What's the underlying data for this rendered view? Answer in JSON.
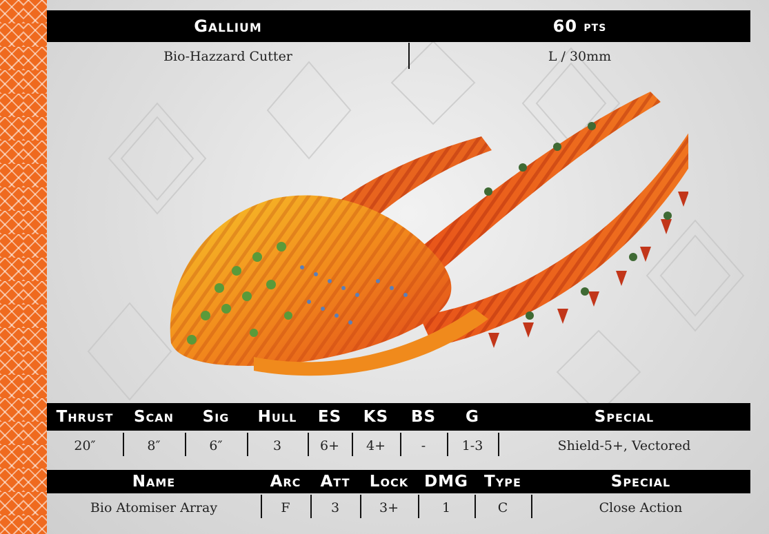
{
  "card": {
    "name": "Gallium",
    "points": "60",
    "points_unit": "pts",
    "class": "Bio-Hazzard Cutter",
    "size": "L / 30mm"
  },
  "stats": {
    "headers": [
      "Thrust",
      "Scan",
      "Sig",
      "Hull",
      "ES",
      "KS",
      "BS",
      "G",
      "Special"
    ],
    "values": [
      "20″",
      "8″",
      "6″",
      "3",
      "6+",
      "4+",
      "-",
      "1-3",
      "Shield-5+, Vectored"
    ]
  },
  "weapons": {
    "headers": [
      "Name",
      "Arc",
      "Att",
      "Lock",
      "DMG",
      "Type",
      "Special"
    ],
    "rows": [
      [
        "Bio Atomiser Array",
        "F",
        "3",
        "3+",
        "1",
        "C",
        "Close Action"
      ]
    ]
  },
  "colors": {
    "stripe": "#ef6a1f",
    "bar": "#000000",
    "ship_primary": "#f28a1c",
    "ship_secondary": "#e0431a"
  }
}
